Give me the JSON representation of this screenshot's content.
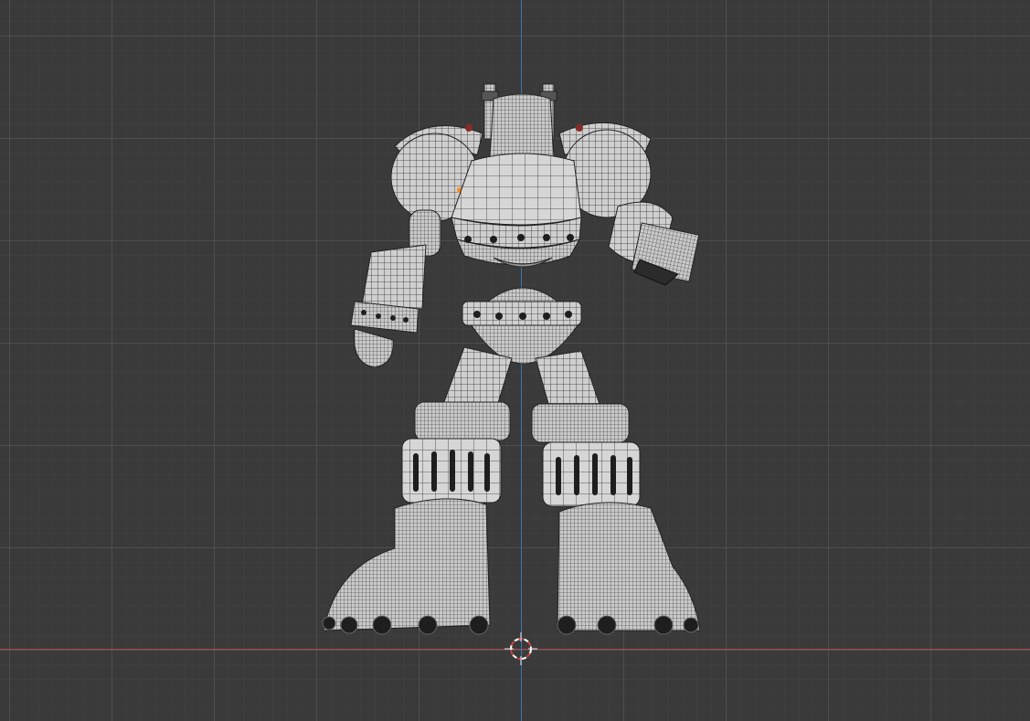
{
  "viewport": {
    "mode": "wireframe",
    "background_color": "#3a3a3a",
    "grid_color": "#5a5a5a",
    "x_axis_color": "#b0464c",
    "z_axis_color": "#3b77b0"
  },
  "model": {
    "description_icon": "robot-mesh",
    "surface_color": "#cfcfcf",
    "wire_color": "#2a2a2a",
    "highlight_color": "#ff8c1a"
  },
  "cursor_3d": {
    "icon": "3d-cursor-icon",
    "colors": [
      "#ffffff",
      "#d04040"
    ]
  }
}
